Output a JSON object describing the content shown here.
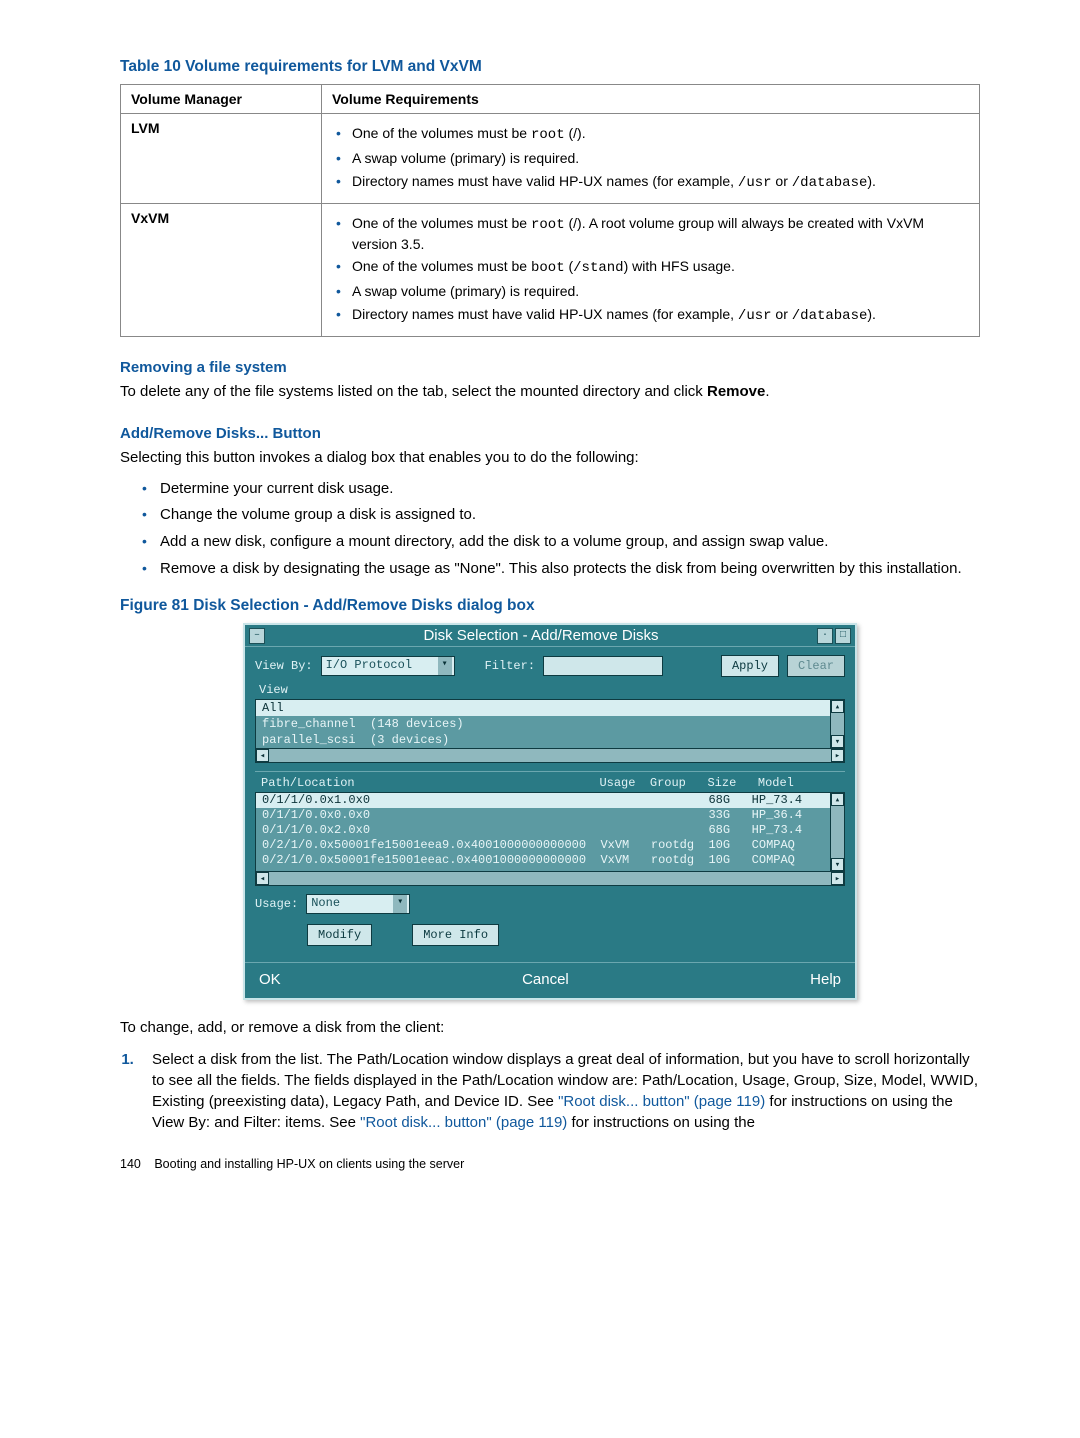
{
  "table_caption": "Table 10 Volume requirements for LVM and VxVM",
  "table": {
    "headers": [
      "Volume Manager",
      "Volume Requirements"
    ],
    "rows": [
      {
        "manager": "LVM",
        "reqs": [
          {
            "pre": "One of the volumes must be ",
            "code": "root",
            "post": " (/)."
          },
          {
            "pre": "A swap volume (primary) is required.",
            "code": "",
            "post": ""
          },
          {
            "pre": "Directory names must have valid HP-UX names (for example, ",
            "code": "/usr",
            "post": " or ",
            "code2": "/database",
            "post2": ")."
          }
        ]
      },
      {
        "manager": "VxVM",
        "reqs": [
          {
            "pre": "One of the volumes must be ",
            "code": "root",
            "post": " (/). A root volume group will always be created with VxVM version 3.5."
          },
          {
            "pre": "One of the volumes must be ",
            "code": "boot",
            "post": " (",
            "code2": "/stand",
            "post2": ") with HFS usage."
          },
          {
            "pre": "A swap volume (primary) is required.",
            "code": "",
            "post": ""
          },
          {
            "pre": "Directory names must have valid HP-UX names (for example, ",
            "code": "/usr",
            "post": " or ",
            "code2": "/database",
            "post2": ")."
          }
        ]
      }
    ]
  },
  "sec1": {
    "title": "Removing a file system",
    "p_a": "To delete any of the file systems listed on the tab, select the mounted directory and click ",
    "p_b": "Remove",
    "p_c": "."
  },
  "sec2": {
    "title": "Add/Remove Disks... Button",
    "intro": "Selecting this button invokes a dialog box that enables you to do the following:",
    "bullets": [
      "Determine your current disk usage.",
      "Change the volume group a disk is assigned to.",
      "Add a new disk, configure a mount directory, add the disk to a volume group, and assign swap value.",
      "Remove a disk by designating the usage as \"None\". This also protects the disk from being overwritten by this installation."
    ]
  },
  "fig_caption": "Figure 81 Disk Selection - Add/Remove Disks dialog box",
  "dialog": {
    "title": "Disk Selection - Add/Remove Disks",
    "view_by_label": "View By:",
    "view_by_value": "I/O Protocol",
    "filter_label": "Filter:",
    "filter_value": "",
    "apply": "Apply",
    "clear": "Clear",
    "view_label": "View",
    "protocols": [
      "All",
      "fibre_channel  (148 devices)",
      "parallel_scsi  (3 devices)"
    ],
    "col_header": "Path/Location                                  Usage  Group   Size   Model",
    "rows": [
      "0/1/1/0.0x1.0x0                                               68G   HP_73.4",
      "0/1/1/0.0x0.0x0                                               33G   HP_36.4",
      "0/1/1/0.0x2.0x0                                               68G   HP_73.4",
      "0/2/1/0.0x50001fe15001eea9.0x4001000000000000  VxVM   rootdg  10G   COMPAQ",
      "0/2/1/0.0x50001fe15001eeac.0x4001000000000000  VxVM   rootdg  10G   COMPAQ"
    ],
    "usage_label": "Usage:",
    "usage_value": "None",
    "modify": "Modify",
    "more_info": "More Info",
    "ok": "OK",
    "cancel": "Cancel",
    "help": "Help"
  },
  "after_fig_p": "To change, add, or remove a disk from the client:",
  "step1": {
    "a": "Select a disk from the list. The Path/Location window displays a great deal of information, but you have to scroll horizontally to see all the fields. The fields displayed in the Path/Location window are: Path/Location, Usage, Group, Size, Model, WWID, Existing (preexisting data), Legacy Path, and Device ID. See ",
    "link1": "\"Root disk... button\" (page 119)",
    "b": " for instructions on using the View By: and Filter: items. See ",
    "link2": "\"Root disk... button\" (page 119)",
    "c": " for instructions on using the"
  },
  "footer": {
    "page": "140",
    "title": "Booting and installing HP-UX on clients using the server"
  }
}
